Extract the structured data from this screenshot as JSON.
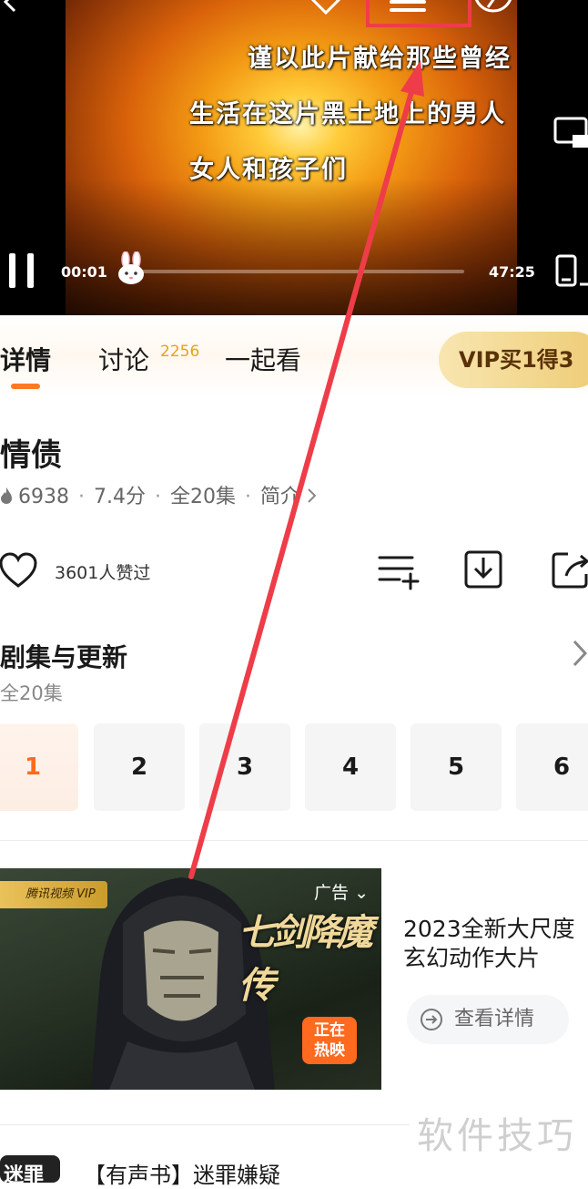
{
  "player": {
    "subtitles": [
      "谨以此片献给那些曾经",
      "生活在这片黑土地上的男人",
      "女人和孩子们"
    ],
    "current_time": "00:01",
    "total_time": "47:25",
    "progress": 0.01,
    "icons": [
      "back-icon",
      "cast-icon",
      "menu-icon",
      "pin-icon",
      "pip-icon",
      "pause-icon",
      "bunny-icon",
      "fullscreen-icon"
    ]
  },
  "tabs": {
    "details": "详情",
    "discuss": "讨论",
    "discuss_count": "2256",
    "watch_together": "一起看",
    "vip": "VIP买1得3"
  },
  "show": {
    "title": "情债",
    "hot": "6938",
    "score": "7.4分",
    "episodes": "全20集",
    "intro": "简介",
    "likes": "3601人赞过"
  },
  "episodes": {
    "heading": "剧集与更新",
    "subtitle": "全20集",
    "items": [
      "1",
      "2",
      "3",
      "4",
      "5",
      "6"
    ],
    "active_index": 0
  },
  "ad": {
    "badge": "腾讯视频 VIP",
    "tag": "广告",
    "calligraphy": "七剑降魔传",
    "live_line1": "正在",
    "live_line2": "热映",
    "title": "2023全新大尺度玄幻动作大片",
    "cta": "查看详情"
  },
  "next_item": {
    "thumb_text": "迷罪",
    "title": "【有声书】迷罪嫌疑"
  },
  "watermark": "软件技巧",
  "colors": {
    "accent_orange": "#ff6a1a",
    "annotation_red": "#ee3d48",
    "vip_gold": "#eecc76",
    "discuss_count": "#e8a21a"
  }
}
